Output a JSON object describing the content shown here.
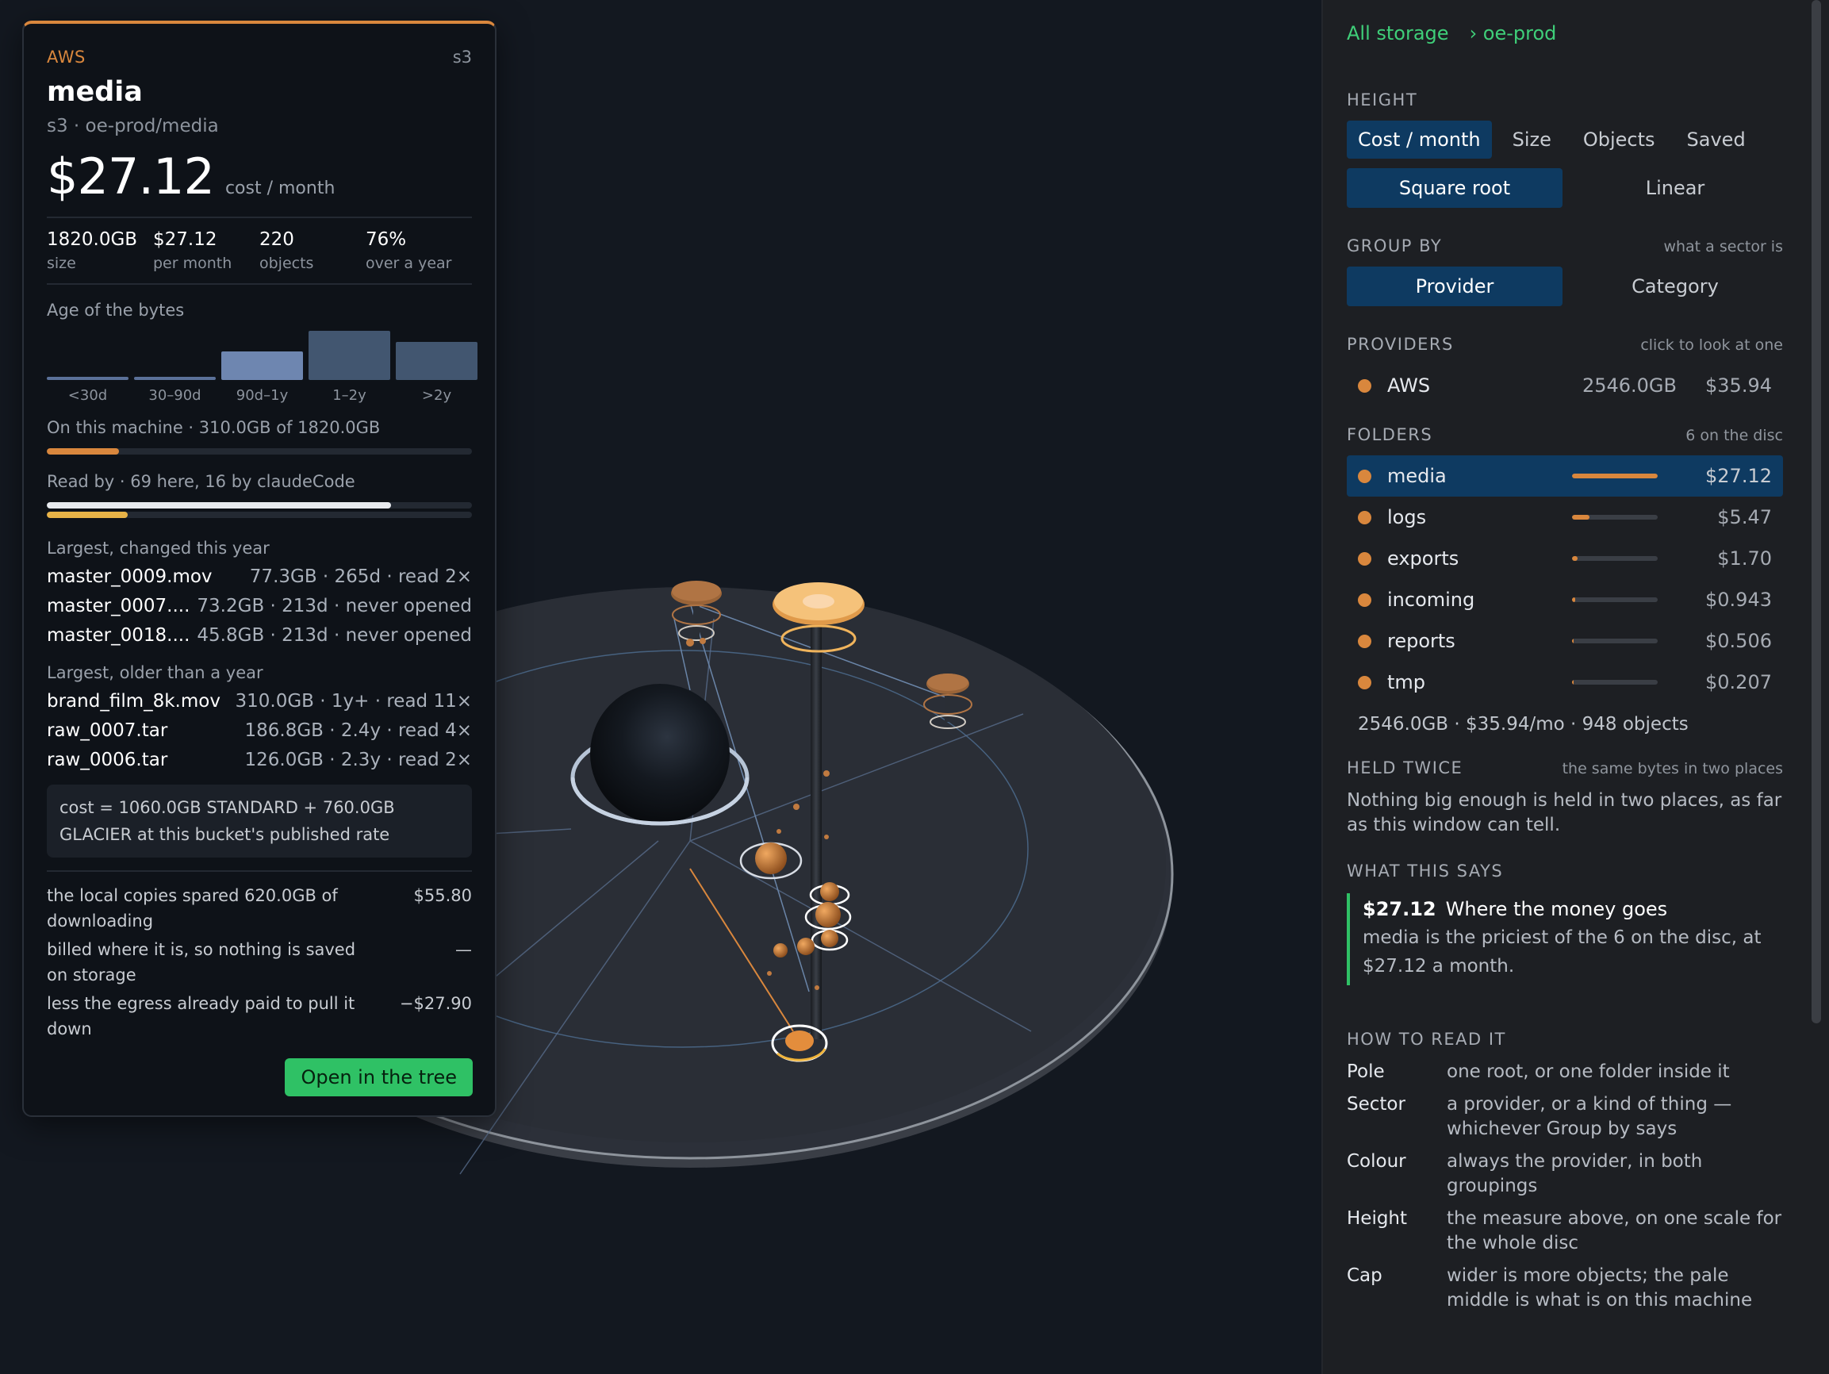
{
  "card": {
    "provider": "AWS",
    "kind": "s3",
    "title": "media",
    "path": "s3 · oe-prod/media",
    "price": "$27.12",
    "price_unit": "cost / month",
    "stats": [
      {
        "value": "1820.0GB",
        "label": "size"
      },
      {
        "value": "$27.12",
        "label": "per month"
      },
      {
        "value": "220",
        "label": "objects"
      },
      {
        "value": "76%",
        "label": "over a year"
      }
    ],
    "age_title": "Age of the bytes",
    "age_bars": [
      {
        "label": "<30d",
        "level": 0.06,
        "color": "#5b7199"
      },
      {
        "label": "30–90d",
        "level": 0.06,
        "color": "#5b7199"
      },
      {
        "label": "90d–1y",
        "level": 0.58,
        "color": "#6e86b0"
      },
      {
        "label": "1–2y",
        "level": 1.0,
        "color": "#425670"
      },
      {
        "label": ">2y",
        "level": 0.77,
        "color": "#425670"
      }
    ],
    "local_text": "On this machine · 310.0GB of 1820.0GB",
    "local_level": 0.17,
    "read_text": "Read by · 69 here, 16 by claudeCode",
    "read_level_here": 0.81,
    "read_level_claude": 0.19,
    "recent_title": "Largest, changed this year",
    "recent_files": [
      {
        "name": "master_0009.mov",
        "detail": "77.3GB · 265d · read 2×"
      },
      {
        "name": "master_0007....",
        "detail": "73.2GB · 213d · never opened"
      },
      {
        "name": "master_0018....",
        "detail": "45.8GB · 213d · never opened"
      }
    ],
    "old_title": "Largest, older than a year",
    "old_files": [
      {
        "name": "brand_film_8k.mov",
        "detail": "310.0GB · 1y+ · read 11×"
      },
      {
        "name": "raw_0007.tar",
        "detail": "186.8GB · 2.4y · read 4×"
      },
      {
        "name": "raw_0006.tar",
        "detail": "126.0GB · 2.3y · read 2×"
      }
    ],
    "cost_note": "cost = 1060.0GB STANDARD + 760.0GB GLACIER at this bucket's published rate",
    "savings": [
      {
        "text": "the local copies spared 620.0GB of downloading",
        "amount": "$55.80"
      },
      {
        "text": "billed where it is, so nothing is saved on storage",
        "amount": "—"
      },
      {
        "text": "less the egress already paid to pull it down",
        "amount": "−$27.90"
      }
    ],
    "open_label": "Open in the tree"
  },
  "panel": {
    "crumbs": [
      "All storage",
      "› oe-prod"
    ],
    "height": {
      "title": "HEIGHT",
      "measures": [
        "Cost / month",
        "Size",
        "Objects",
        "Saved"
      ],
      "selected_measure": "Cost / month",
      "scales": [
        "Square root",
        "Linear"
      ],
      "selected_scale": "Square root"
    },
    "group": {
      "title": "GROUP BY",
      "hint": "what a sector is",
      "options": [
        "Provider",
        "Category"
      ],
      "selected": "Provider"
    },
    "providers": {
      "title": "PROVIDERS",
      "hint": "click to look at one",
      "items": [
        {
          "name": "AWS",
          "size": "2546.0GB",
          "price": "$35.94"
        }
      ]
    },
    "folders": {
      "title": "FOLDERS",
      "hint": "6 on the disc",
      "items": [
        {
          "name": "media",
          "amount": "$27.12",
          "share": 1.0,
          "selected": true
        },
        {
          "name": "logs",
          "amount": "$5.47",
          "share": 0.2
        },
        {
          "name": "exports",
          "amount": "$1.70",
          "share": 0.063
        },
        {
          "name": "incoming",
          "amount": "$0.943",
          "share": 0.035
        },
        {
          "name": "reports",
          "amount": "$0.506",
          "share": 0.019
        },
        {
          "name": "tmp",
          "amount": "$0.207",
          "share": 0.008
        }
      ],
      "summary": "2546.0GB · $35.94/mo · 948 objects"
    },
    "twice": {
      "title": "HELD TWICE",
      "hint": "the same bytes in two places",
      "text": "Nothing big enough is held in two places, as far as this window can tell."
    },
    "says": {
      "title": "WHAT THIS SAYS",
      "value": "$27.12",
      "headline": "Where the money goes",
      "body": "media is the priciest of the 6 on the disc, at $27.12 a month."
    },
    "howto": {
      "title": "HOW TO READ IT",
      "items": [
        {
          "key": "Pole",
          "desc": "one root, or one folder inside it"
        },
        {
          "key": "Sector",
          "desc": "a provider, or a kind of thing — whichever Group by says"
        },
        {
          "key": "Colour",
          "desc": "always the provider, in both groupings"
        },
        {
          "key": "Height",
          "desc": "the measure above, on one scale for the whole disc"
        },
        {
          "key": "Cap",
          "desc": "wider is more objects; the pale middle is what is on this machine"
        }
      ]
    }
  }
}
